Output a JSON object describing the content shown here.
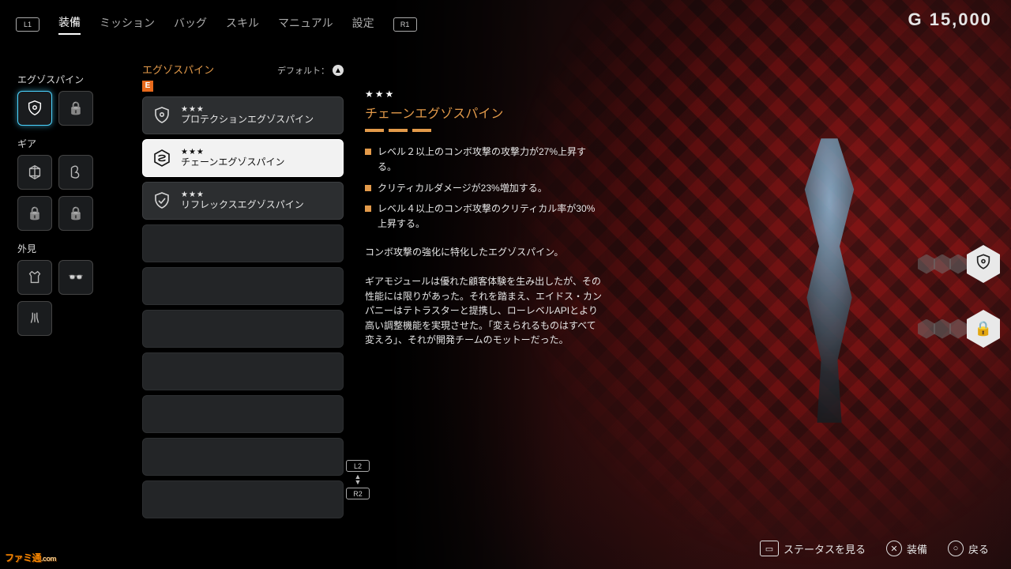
{
  "header": {
    "l1": "L1",
    "r1": "R1",
    "tabs": [
      "装備",
      "ミッション",
      "バッグ",
      "スキル",
      "マニュアル",
      "設定"
    ],
    "active_tab_index": 0,
    "currency_label": "G",
    "currency_value": "15,000"
  },
  "sidebar": {
    "exospine_label": "エグゾスパイン",
    "gear_label": "ギア",
    "appearance_label": "外見"
  },
  "list": {
    "title": "エグゾスパイン",
    "badge": "E",
    "default_label": "デフォルト：",
    "default_button": "▲",
    "items": [
      {
        "stars": "★★★",
        "name": "プロテクションエグゾスパイン"
      },
      {
        "stars": "★★★",
        "name": "チェーンエグゾスパイン"
      },
      {
        "stars": "★★★",
        "name": "リフレックスエグゾスパイン"
      }
    ],
    "selected_index": 1,
    "scroll_l2": "L2",
    "scroll_r2": "R2",
    "scroll_arrows": "▲▼"
  },
  "detail": {
    "stars": "★★★",
    "title": "チェーンエグゾスパイン",
    "bullets": [
      "レベル２以上のコンボ攻撃の攻撃力が27%上昇する。",
      "クリティカルダメージが23%増加する。",
      "レベル４以上のコンボ攻撃のクリティカル率が30%上昇する。"
    ],
    "summary": "コンボ攻撃の強化に特化したエグゾスパイン。",
    "body": "ギアモジュールは優れた顧客体験を生み出したが、その性能には限りがあった。それを踏まえ、エイドス・カンパニーはテトラスターと提携し、ローレベルAPIとより高い調整機能を実現させた。「変えられるものはすべて変えろ」、それが開発チームのモットーだった。"
  },
  "footer": {
    "touchpad": "ステータスを見る",
    "cross": "装備",
    "circle": "戻る"
  },
  "watermark": {
    "brand": "ファミ通",
    "suffix": ".com"
  }
}
